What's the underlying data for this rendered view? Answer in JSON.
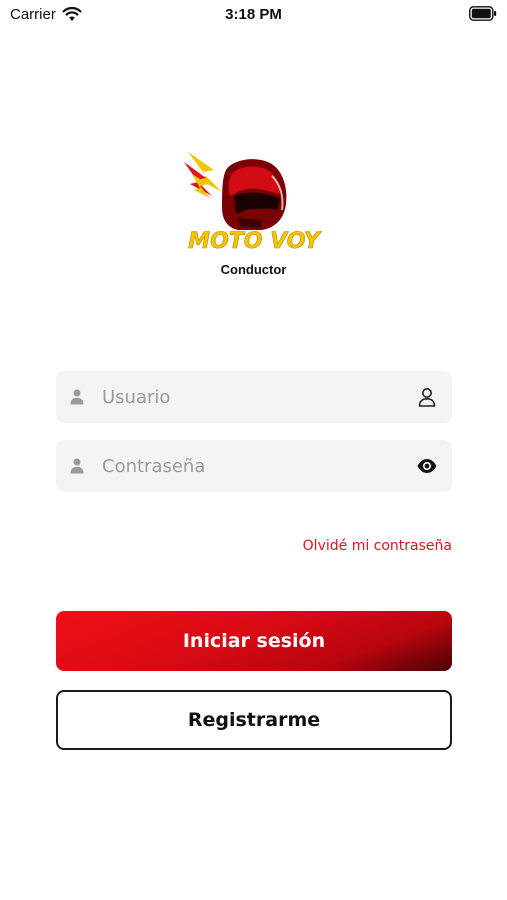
{
  "status_bar": {
    "carrier": "Carrier",
    "time": "3:18 PM",
    "wifi_icon": "wifi-icon",
    "battery_icon": "battery-icon"
  },
  "logo": {
    "brand_text": "MOTO VOY",
    "subtitle": "Conductor",
    "icon": "helmet-lightning-logo"
  },
  "login_form": {
    "username": {
      "value": "",
      "placeholder": "Usuario",
      "lead_icon": "person-icon",
      "trail_icon": "user-outline-icon"
    },
    "password": {
      "value": "",
      "placeholder": "Contraseña",
      "lead_icon": "person-icon",
      "trail_icon": "eye-icon"
    },
    "forgot_password": "Olvidé mi contraseña",
    "login_button": "Iniciar sesión",
    "register_button": "Registrarme"
  },
  "colors": {
    "accent_red": "#e0141e",
    "dark_red": "#4a0005",
    "field_bg": "#f4f4f5",
    "logo_yellow": "#f5c400"
  }
}
